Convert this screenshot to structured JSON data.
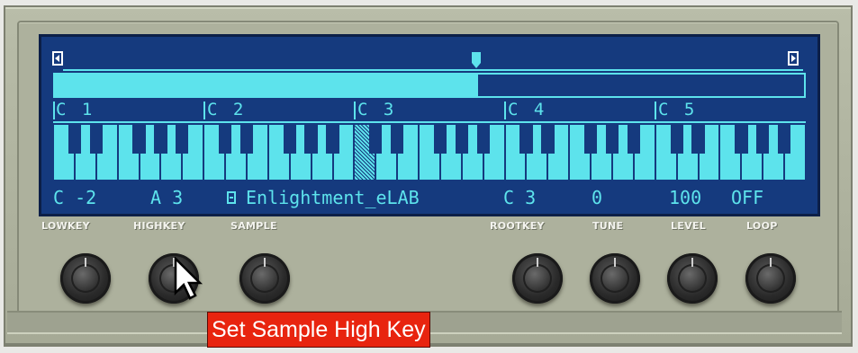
{
  "window": {
    "title": ""
  },
  "display": {
    "zone_split_fraction": 0.565,
    "octave_labels": [
      "C 1",
      "C 2",
      "C 3",
      "C 4",
      "C 5"
    ],
    "selected_key": "C 3",
    "info": {
      "lowkey": "C -2",
      "highkey": "A 3",
      "sample_name": "Enlightment_eLAB",
      "rootkey": "C 3",
      "tune": "0",
      "level": "100",
      "loop": "OFF"
    }
  },
  "labels": {
    "lowkey": "LOWKEY",
    "highkey": "HIGHKEY",
    "sample": "SAMPLE",
    "rootkey": "ROOTKEY",
    "tune": "TUNE",
    "level": "LEVEL",
    "loop": "LOOP"
  },
  "tooltip": {
    "text": "Set Sample High Key"
  },
  "colors": {
    "screen_bg": "#153a7e",
    "screen_fg": "#5de3ec",
    "panel": "#adb19d",
    "tooltip_bg": "#e8240f"
  },
  "icons": [
    "scroll-left-icon",
    "scroll-right-icon",
    "zone-marker-icon",
    "sample-icon",
    "mouse-cursor-icon"
  ]
}
